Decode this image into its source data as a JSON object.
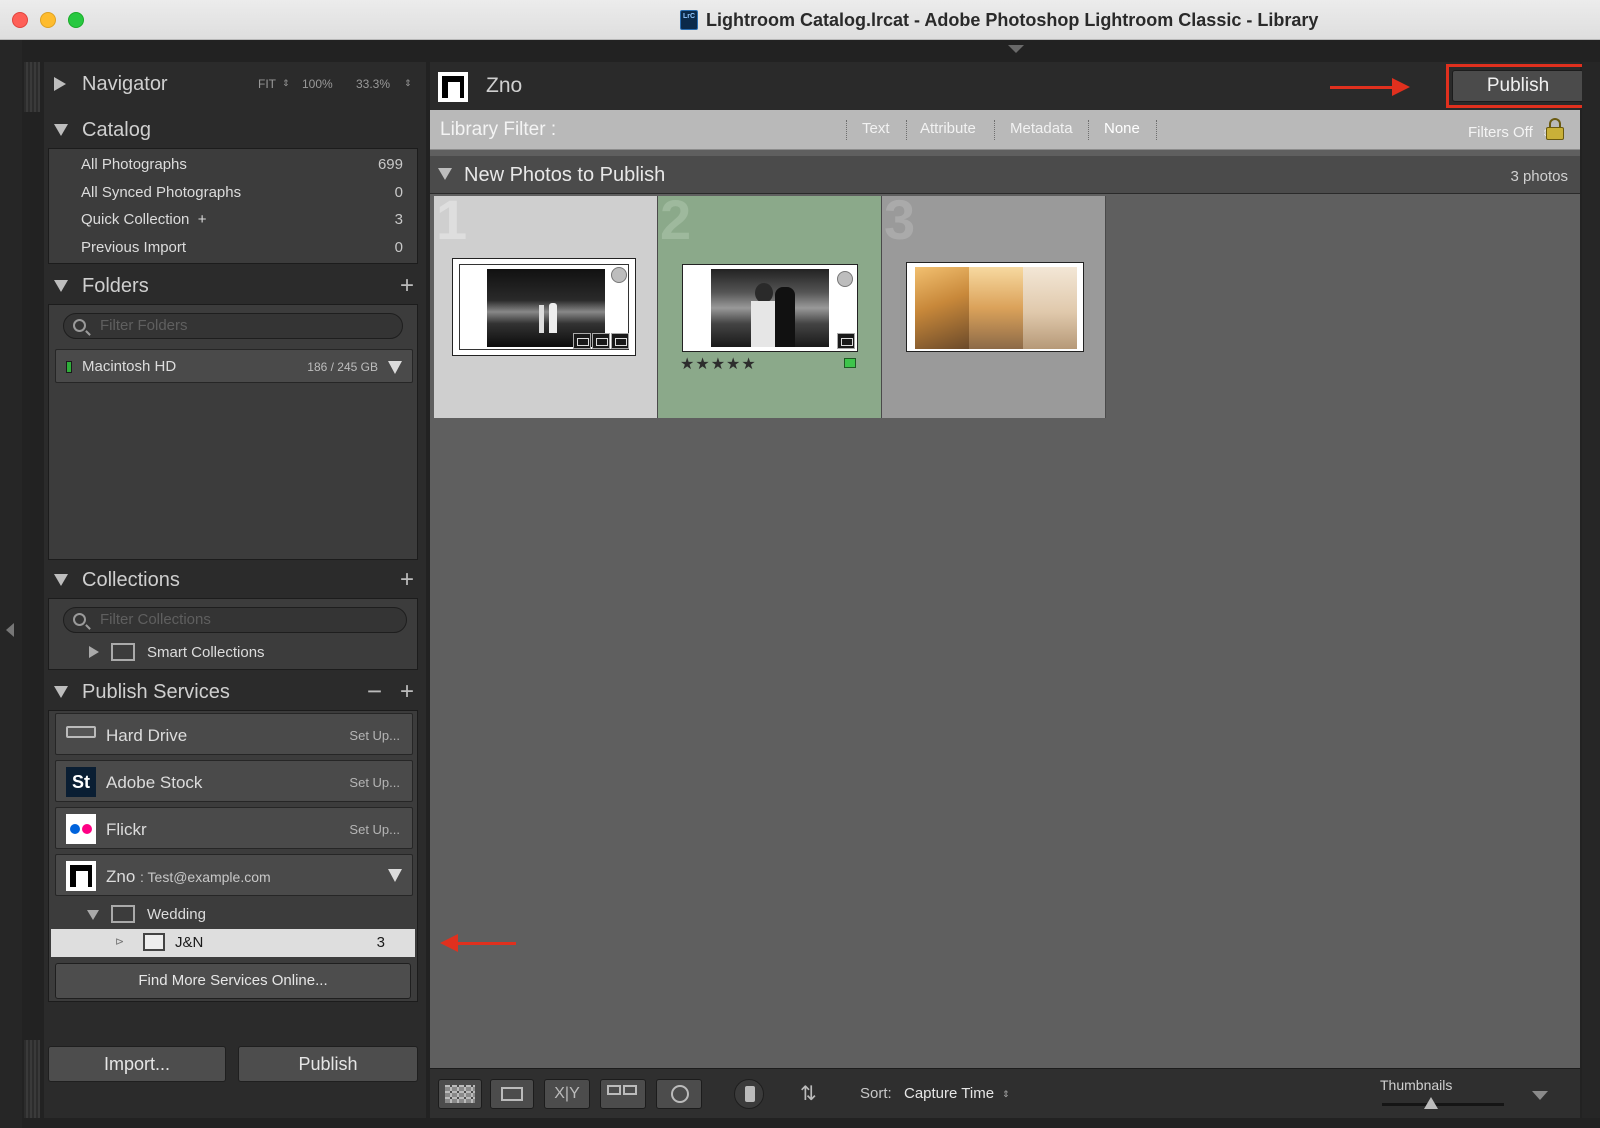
{
  "window": {
    "title": "Lightroom Catalog.lrcat - Adobe Photoshop Lightroom Classic - Library",
    "app_icon_text": "LrC"
  },
  "navigator": {
    "label": "Navigator",
    "zoom_options": [
      "FIT",
      "100%",
      "33.3%"
    ]
  },
  "catalog": {
    "label": "Catalog",
    "items": [
      {
        "name": "All Photographs",
        "count": "699"
      },
      {
        "name": "All Synced Photographs",
        "count": "0"
      },
      {
        "name": "Quick Collection  +",
        "count": "3"
      },
      {
        "name": "Previous Import",
        "count": "0"
      }
    ]
  },
  "folders": {
    "label": "Folders",
    "filter_placeholder": "Filter Folders",
    "volume": {
      "name": "Macintosh HD",
      "size": "186 / 245 GB",
      "status_color": "#2fae3a"
    }
  },
  "collections": {
    "label": "Collections",
    "filter_placeholder": "Filter Collections",
    "items": [
      {
        "name": "Smart Collections"
      }
    ]
  },
  "publish_services": {
    "label": "Publish Services",
    "services": [
      {
        "name": "Hard Drive",
        "action": "Set Up...",
        "icon": "hard-drive-icon"
      },
      {
        "name": "Adobe Stock",
        "action": "Set Up...",
        "icon": "adobe-stock-icon",
        "icon_text": "St"
      },
      {
        "name": "Flickr",
        "action": "Set Up...",
        "icon": "flickr-icon"
      }
    ],
    "zno": {
      "name": "Zno",
      "account": ": Test@example.com"
    },
    "tree": {
      "folder": "Wedding",
      "collection": {
        "name": "J&N",
        "count": "3"
      }
    },
    "find_more": "Find More Services Online..."
  },
  "bottom_buttons": {
    "import": "Import...",
    "publish": "Publish"
  },
  "header": {
    "title": "Zno",
    "publish_button": "Publish"
  },
  "library_filter": {
    "label": "Library Filter :",
    "options": [
      "Text",
      "Attribute",
      "Metadata",
      "None"
    ],
    "active": "None",
    "status": "Filters Off"
  },
  "grid": {
    "section_title": "New Photos to Publish",
    "count_text": "3 photos",
    "cells": [
      {
        "index": "1",
        "rating": 0
      },
      {
        "index": "2",
        "rating": 5,
        "stars": "★★★★★",
        "color_label": "#3ec44b"
      },
      {
        "index": "3",
        "rating": 0
      }
    ]
  },
  "toolbar": {
    "sort_label": "Sort:",
    "sort_value": "Capture Time",
    "thumbnails_label": "Thumbnails",
    "thumbnail_size": 0.4
  },
  "colors": {
    "accent_red": "#e0301e",
    "selected_cell_bg": "#8ba98a"
  }
}
